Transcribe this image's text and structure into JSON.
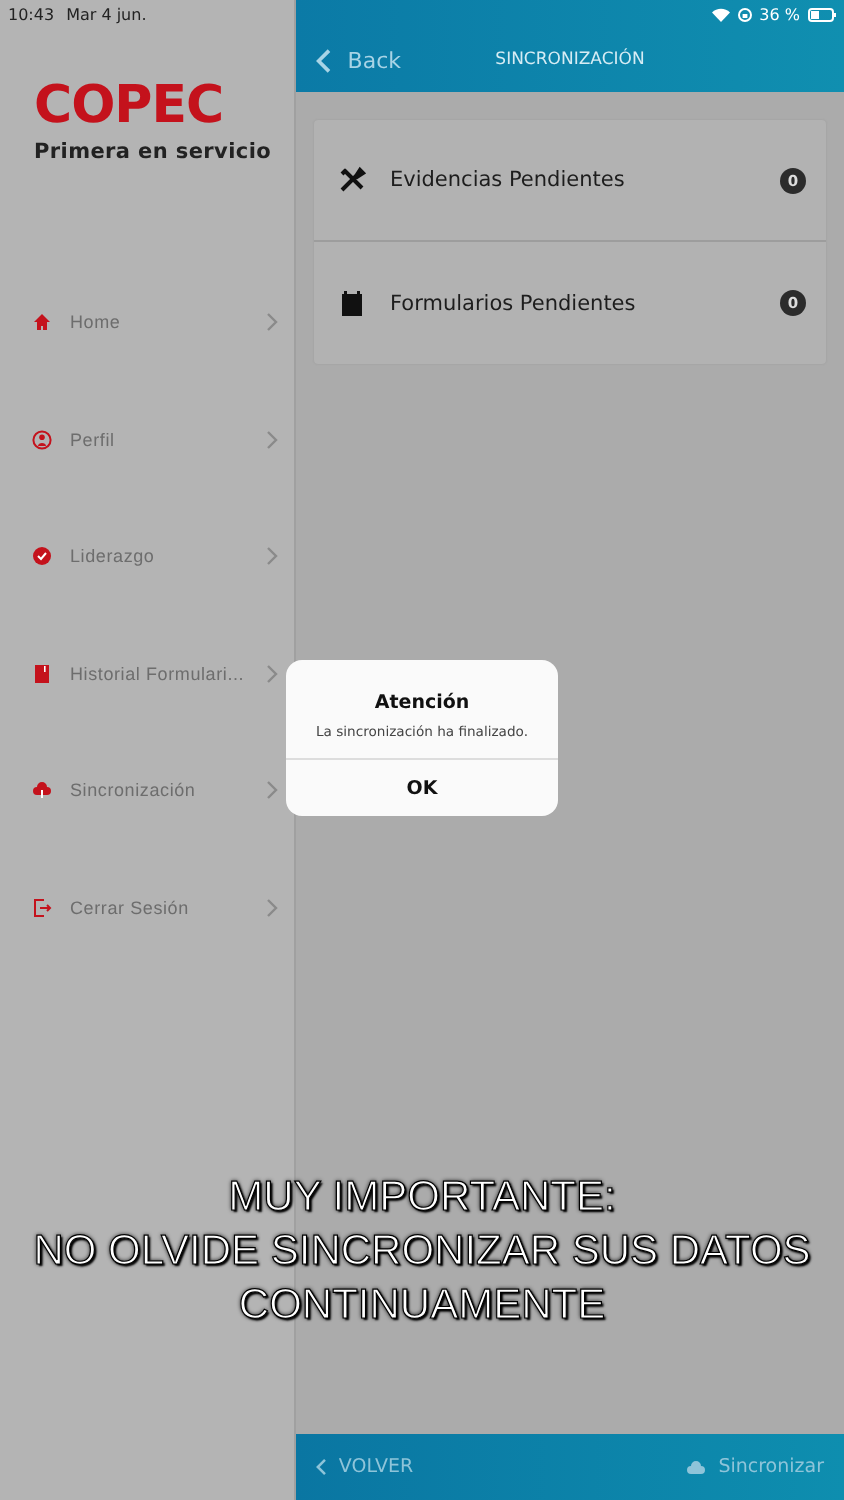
{
  "status_bar": {
    "time": "10:43",
    "date": "Mar 4 jun.",
    "battery": "36 %"
  },
  "sidebar": {
    "logo": "COPEC",
    "tagline": "Primera en servicio",
    "items": [
      {
        "label": "Home",
        "kind": "home"
      },
      {
        "label": "Perfil",
        "kind": "user"
      },
      {
        "label": "Liderazgo",
        "kind": "check"
      },
      {
        "label": "Historial Formulari...",
        "kind": "book"
      },
      {
        "label": "Sincronización",
        "kind": "cloud"
      },
      {
        "label": "Cerrar Sesión",
        "kind": "logout"
      }
    ]
  },
  "header": {
    "back": "Back",
    "title": "SINCRONIZACIÓN"
  },
  "pending": [
    {
      "label": "Evidencias Pendientes",
      "count": "0",
      "kind": "tools"
    },
    {
      "label": "Formularios Pendientes",
      "count": "0",
      "kind": "calendar"
    }
  ],
  "dialog": {
    "title": "Atención",
    "message": "La sincronización ha finalizado.",
    "button": "OK"
  },
  "caption": [
    "MUY IMPORTANTE:",
    "NO OLVIDE SINCRONIZAR SUS DATOS",
    "CONTINUAMENTE"
  ],
  "footer": {
    "back": "VOLVER",
    "sync": "Sincronizar"
  }
}
